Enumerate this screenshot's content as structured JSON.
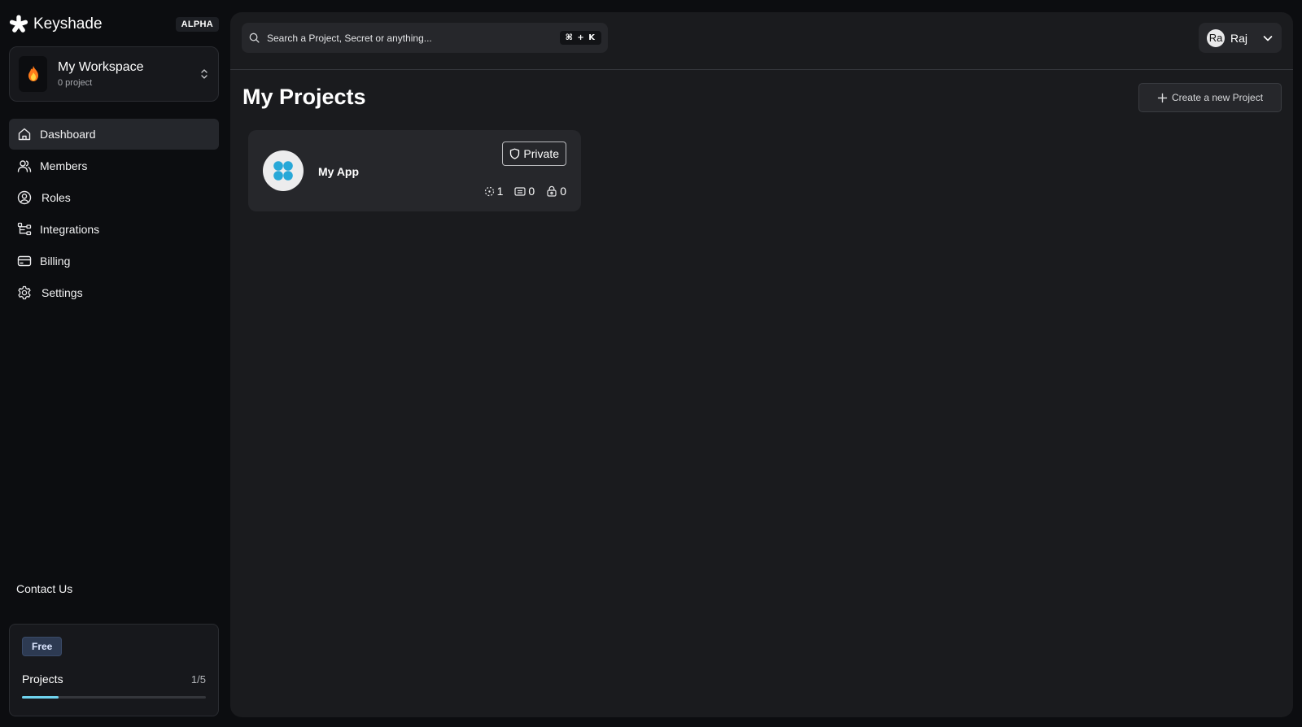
{
  "app": {
    "name": "Keyshade",
    "badge": "ALPHA"
  },
  "workspace": {
    "icon": "fire-emoji-icon",
    "name": "My Workspace",
    "subtitle": "0 project"
  },
  "sidebar": {
    "items": [
      {
        "label": "Dashboard",
        "icon": "home-icon",
        "active": true
      },
      {
        "label": "Members",
        "icon": "users-icon"
      },
      {
        "label": "Roles",
        "icon": "user-circle-icon"
      },
      {
        "label": "Integrations",
        "icon": "integrations-icon"
      },
      {
        "label": "Billing",
        "icon": "credit-card-icon"
      },
      {
        "label": "Settings",
        "icon": "gear-icon"
      }
    ],
    "contact": "Contact Us",
    "plan": {
      "badge": "Free",
      "label": "Projects",
      "count": "1/5",
      "usage": 0.2,
      "accent": "#6fd3ee"
    }
  },
  "header": {
    "search_placeholder": "Search a Project, Secret or anything...",
    "shortcut": "⌘ + K",
    "user": {
      "initials": "Ra",
      "name": "Raj"
    }
  },
  "main": {
    "title": "My Projects",
    "create_label": "Create a new Project",
    "projects": [
      {
        "name": "My App",
        "visibility": "Private",
        "environments": "1",
        "variables": "0",
        "secrets": "0",
        "icon_color": "#27a8d8"
      }
    ]
  }
}
